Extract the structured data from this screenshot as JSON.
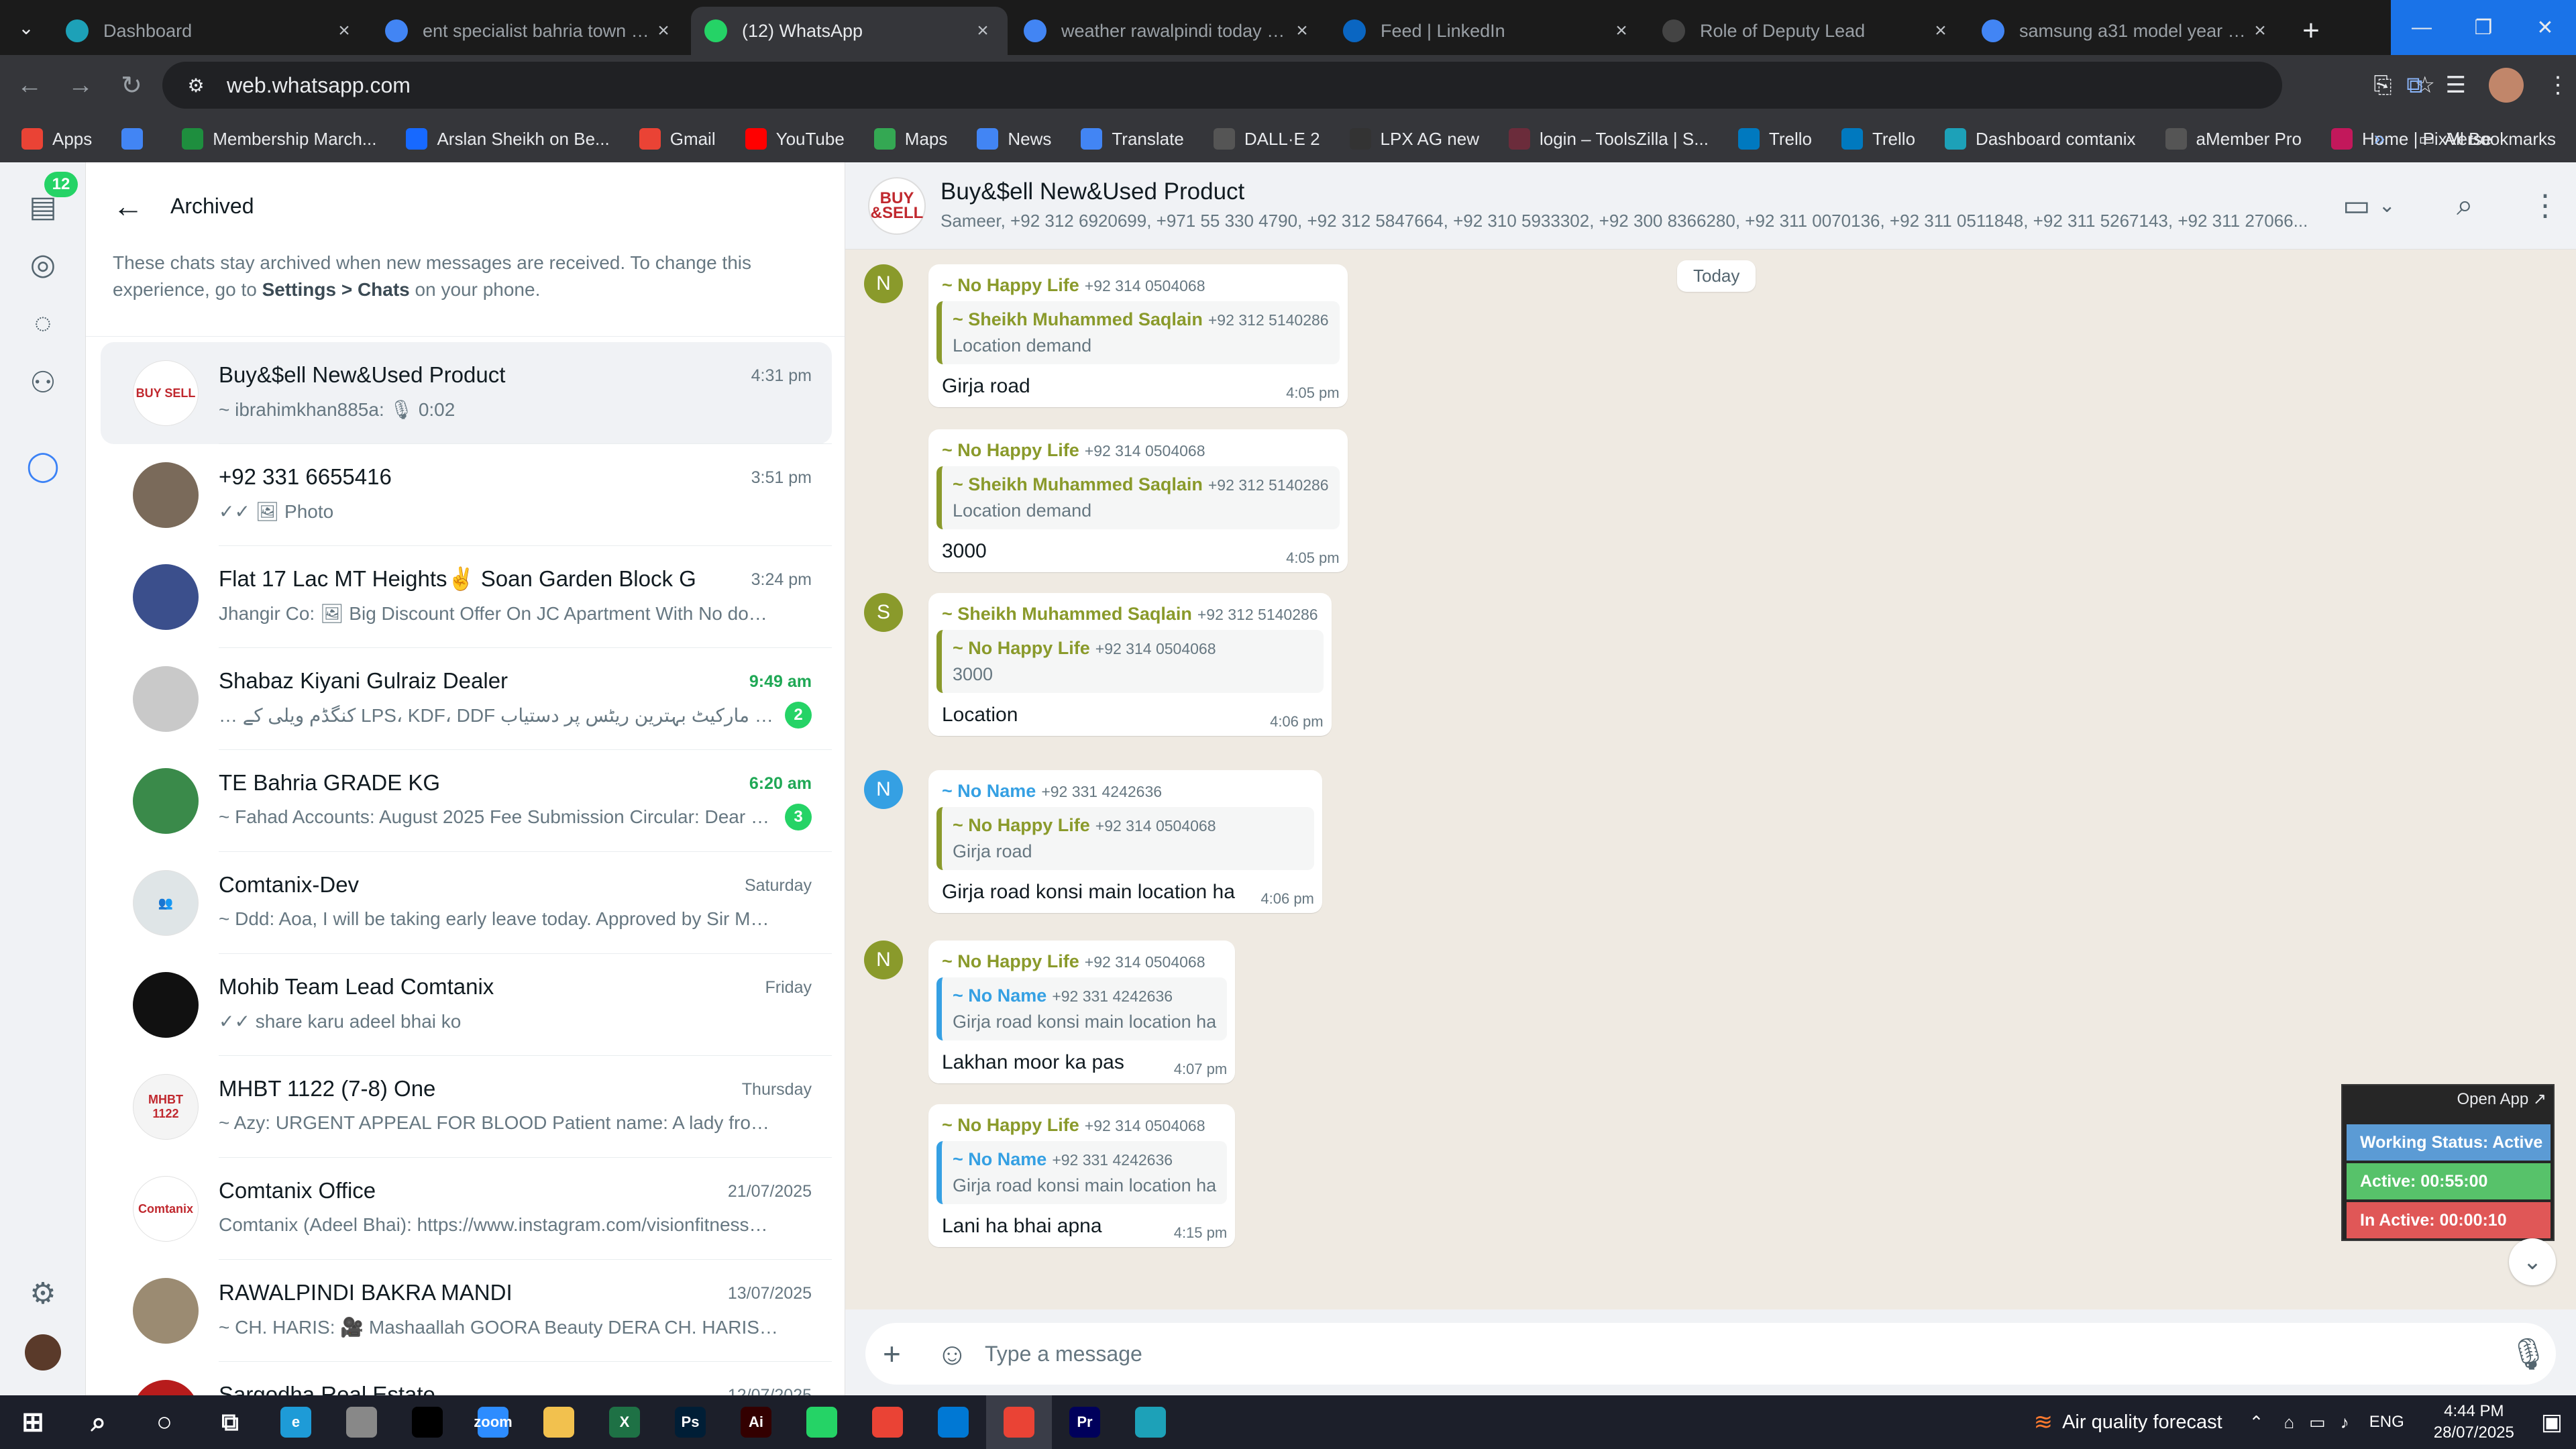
{
  "browser": {
    "tabs": [
      {
        "label": "Dashboard",
        "icon": "dashboard-favicon",
        "color": "#1da1b8",
        "active": false
      },
      {
        "label": "ent specialist bahria town rawalpindi",
        "icon": "google-favicon",
        "color": "#4285f4",
        "active": false
      },
      {
        "label": "(12) WhatsApp",
        "icon": "whatsapp-favicon",
        "color": "#25d366",
        "active": true
      },
      {
        "label": "weather rawalpindi today - Google Search",
        "icon": "google-favicon",
        "color": "#4285f4",
        "active": false
      },
      {
        "label": "Feed | LinkedIn",
        "icon": "linkedin-favicon",
        "color": "#0a66c2",
        "active": false
      },
      {
        "label": "Role of Deputy Lead",
        "icon": "openai-favicon",
        "color": "#444444",
        "active": false
      },
      {
        "label": "samsung a31 model year - Google Search",
        "icon": "google-favicon",
        "color": "#4285f4",
        "active": false
      }
    ],
    "url": "web.whatsapp.com",
    "bookmarks": [
      {
        "label": "Apps",
        "color": "#ea4335"
      },
      {
        "label": "",
        "color": "#4285f4"
      },
      {
        "label": "Membership March...",
        "color": "#1e8e3e"
      },
      {
        "label": "Arslan Sheikh on Be...",
        "color": "#1769ff"
      },
      {
        "label": "Gmail",
        "color": "#ea4335"
      },
      {
        "label": "YouTube",
        "color": "#ff0000"
      },
      {
        "label": "Maps",
        "color": "#34a853"
      },
      {
        "label": "News",
        "color": "#4285f4"
      },
      {
        "label": "Translate",
        "color": "#4285f4"
      },
      {
        "label": "DALL·E 2",
        "color": "#555555"
      },
      {
        "label": "LPX AG new",
        "color": "#333333"
      },
      {
        "label": "login – ToolsZilla | S...",
        "color": "#6b2c3b"
      },
      {
        "label": "Trello",
        "color": "#0079bf"
      },
      {
        "label": "Trello",
        "color": "#0079bf"
      },
      {
        "label": "Dashboard comtanix",
        "color": "#1da1b8"
      },
      {
        "label": "aMember Pro",
        "color": "#555555"
      },
      {
        "label": "Home | PixVerse",
        "color": "#c2185b"
      }
    ],
    "all_bookmarks": "All Bookmarks"
  },
  "rail": {
    "badge": "12"
  },
  "archived": {
    "title": "Archived",
    "note_pre": "These chats stay archived when new messages are received. To change this experience, go to ",
    "note_bold": "Settings > Chats",
    "note_post": " on your phone."
  },
  "chats": [
    {
      "name": "Buy&$ell New&Used Product",
      "time": "4:31 pm",
      "preview": "~ ibrahimkhan885a: 🎙 0:02",
      "badge": "",
      "unread": false,
      "avatar_color": "#ffffff",
      "avatar_text": "BUY SELL"
    },
    {
      "name": "+92 331 6655416",
      "time": "3:51 pm",
      "preview": "✓✓ 🖼 Photo",
      "badge": "",
      "unread": false,
      "avatar_color": "#7a6a5a",
      "avatar_text": ""
    },
    {
      "name": "Flat 17 Lac MT Heights✌️  Soan Garden Block G",
      "time": "3:24 pm",
      "preview": "Jhangir Co: 🖼 Big Discount Offer  On JC Apartment  With No down ...",
      "badge": "",
      "unread": false,
      "avatar_color": "#3b4f8c",
      "avatar_text": ""
    },
    {
      "name": "Shabaz Kiyani Gulraiz Dealer",
      "time": "9:49 am",
      "preview": "… کنگڈم ویلی کے LPS، KDF، DDF اور مرجنگ مارکیٹ بہترین ریٹس پر دستیاب",
      "badge": "2",
      "unread": true,
      "avatar_color": "#c9c9c9",
      "avatar_text": ""
    },
    {
      "name": "TE Bahria GRADE KG",
      "time": "6:20 am",
      "preview": "~ Fahad Accounts: August 2025 Fee Submission Circular: Dear Par...",
      "badge": "3",
      "unread": true,
      "avatar_color": "#3a8a4a",
      "avatar_text": ""
    },
    {
      "name": "Comtanix-Dev",
      "time": "Saturday",
      "preview": "~ Ddd: Aoa, I will be taking early leave today. Approved by  Sir Muhib.",
      "badge": "",
      "unread": false,
      "avatar_color": "#dfe5e7",
      "avatar_text": "👥"
    },
    {
      "name": "Mohib Team Lead Comtanix",
      "time": "Friday",
      "preview": "✓✓ share karu adeel bhai ko",
      "badge": "",
      "unread": false,
      "avatar_color": "#111111",
      "avatar_text": ""
    },
    {
      "name": "MHBT 1122 (7-8) One",
      "time": "Thursday",
      "preview": "~ Azy: URGENT APPEAL FOR BLOOD  Patient name: A lady from Sikan...",
      "badge": "",
      "unread": false,
      "avatar_color": "#f4f4f4",
      "avatar_text": "MHBT 1122"
    },
    {
      "name": "Comtanix Office",
      "time": "21/07/2025",
      "preview": "Comtanix (Adeel Bhai): https://www.instagram.com/visionfitness_bah...",
      "badge": "",
      "unread": false,
      "avatar_color": "#ffffff",
      "avatar_text": "Comtanix"
    },
    {
      "name": "RAWALPINDI BAKRA MANDI",
      "time": "13/07/2025",
      "preview": "~ CH. HARIS: 🎥 Mashaallah GOORA  Beauty DERA CH. HARIS. DAA ...",
      "badge": "",
      "unread": false,
      "avatar_color": "#9b8b72",
      "avatar_text": ""
    },
    {
      "name": "Sargodha Real Estate",
      "time": "12/07/2025",
      "preview": "",
      "badge": "",
      "unread": false,
      "avatar_color": "#b71c1c",
      "avatar_text": ""
    }
  ],
  "conversation": {
    "group_name": "Buy&$ell New&Used Product",
    "members": "Sameer, +92 312 6920699, +971 55 330 4790, +92 312 5847664, +92 310 5933302, +92 300 8366280, +92 311 0070136, +92 311 0511848, +92 311 5267143, +92 311 27066...",
    "day": "Today",
    "messages": [
      {
        "avatar": "N",
        "avatar_color": "#8a9a2b",
        "sender": "~ No Happy Life",
        "sender_phone": "+92 314 0504068",
        "sender_color": "green",
        "quote_sender": "~ Sheikh Muhammed Saqlain",
        "quote_phone": "+92 312 5140286",
        "quote_color": "green",
        "quote_text": "Location demand",
        "text": "Girja road",
        "time": "4:05 pm"
      },
      {
        "avatar": "",
        "avatar_color": "",
        "sender": "~ No Happy Life",
        "sender_phone": "+92 314 0504068",
        "sender_color": "green",
        "quote_sender": "~ Sheikh Muhammed Saqlain",
        "quote_phone": "+92 312 5140286",
        "quote_color": "green",
        "quote_text": "Location demand",
        "text": "3000",
        "time": "4:05 pm"
      },
      {
        "avatar": "S",
        "avatar_color": "#8a9a2b",
        "sender": "~ Sheikh Muhammed Saqlain",
        "sender_phone": "+92 312 5140286",
        "sender_color": "green",
        "quote_sender": "~ No Happy Life",
        "quote_phone": "+92 314 0504068",
        "quote_color": "green",
        "quote_text": "3000",
        "text": "Location",
        "time": "4:06 pm"
      },
      {
        "avatar": "N",
        "avatar_color": "#35a0e3",
        "sender": "~ No Name",
        "sender_phone": "+92 331 4242636",
        "sender_color": "blue",
        "quote_sender": "~ No Happy Life",
        "quote_phone": "+92 314 0504068",
        "quote_color": "green",
        "quote_text": "Girja road",
        "text": "Girja road konsi main location ha",
        "time": "4:06 pm"
      },
      {
        "avatar": "N",
        "avatar_color": "#8a9a2b",
        "sender": "~ No Happy Life",
        "sender_phone": "+92 314 0504068",
        "sender_color": "green",
        "quote_sender": "~ No Name",
        "quote_phone": "+92 331 4242636",
        "quote_color": "blue",
        "quote_text": "Girja road konsi main location ha",
        "text": "Lakhan moor ka pas",
        "time": "4:07 pm"
      },
      {
        "avatar": "",
        "avatar_color": "",
        "sender": "~ No Happy Life",
        "sender_phone": "+92 314 0504068",
        "sender_color": "green",
        "quote_sender": "~ No Name",
        "quote_phone": "+92 331 4242636",
        "quote_color": "blue",
        "quote_text": "Girja road konsi main location ha",
        "text": "Lani ha bhai apna",
        "time": "4:15 pm"
      }
    ],
    "composer_placeholder": "Type a message"
  },
  "widget": {
    "open_app": "Open App ↗",
    "status": "Working Status: Active",
    "active": "Active: 00:55:00",
    "inactive": "In Active: 00:00:10"
  },
  "taskbar": {
    "apps": [
      {
        "name": "start",
        "color": "#ffffff",
        "label": ""
      },
      {
        "name": "search",
        "color": "#ffffff",
        "label": ""
      },
      {
        "name": "cortana",
        "color": "#ffffff",
        "label": ""
      },
      {
        "name": "task-view",
        "color": "#ffffff",
        "label": ""
      },
      {
        "name": "edge",
        "color": "#1e9bd7",
        "label": "e"
      },
      {
        "name": "pen",
        "color": "#888888",
        "label": ""
      },
      {
        "name": "terminal",
        "color": "#000000",
        "label": ""
      },
      {
        "name": "zoom",
        "color": "#2d8cff",
        "label": "zoom"
      },
      {
        "name": "explorer",
        "color": "#f2c14e",
        "label": ""
      },
      {
        "name": "excel",
        "color": "#1e7145",
        "label": "X"
      },
      {
        "name": "photoshop",
        "color": "#001e36",
        "label": "Ps"
      },
      {
        "name": "illustrator",
        "color": "#330000",
        "label": "Ai"
      },
      {
        "name": "phone",
        "color": "#25d366",
        "label": ""
      },
      {
        "name": "chrome",
        "color": "#ea4335",
        "label": ""
      },
      {
        "name": "vscode",
        "color": "#0078d4",
        "label": ""
      },
      {
        "name": "chrome-active",
        "color": "#ea4335",
        "label": ""
      },
      {
        "name": "premiere",
        "color": "#00005b",
        "label": "Pr"
      },
      {
        "name": "tool",
        "color": "#1da1b8",
        "label": ""
      }
    ],
    "air_quality": "Air quality forecast",
    "lang": "ENG",
    "time": "4:44 PM",
    "date": "28/07/2025"
  }
}
